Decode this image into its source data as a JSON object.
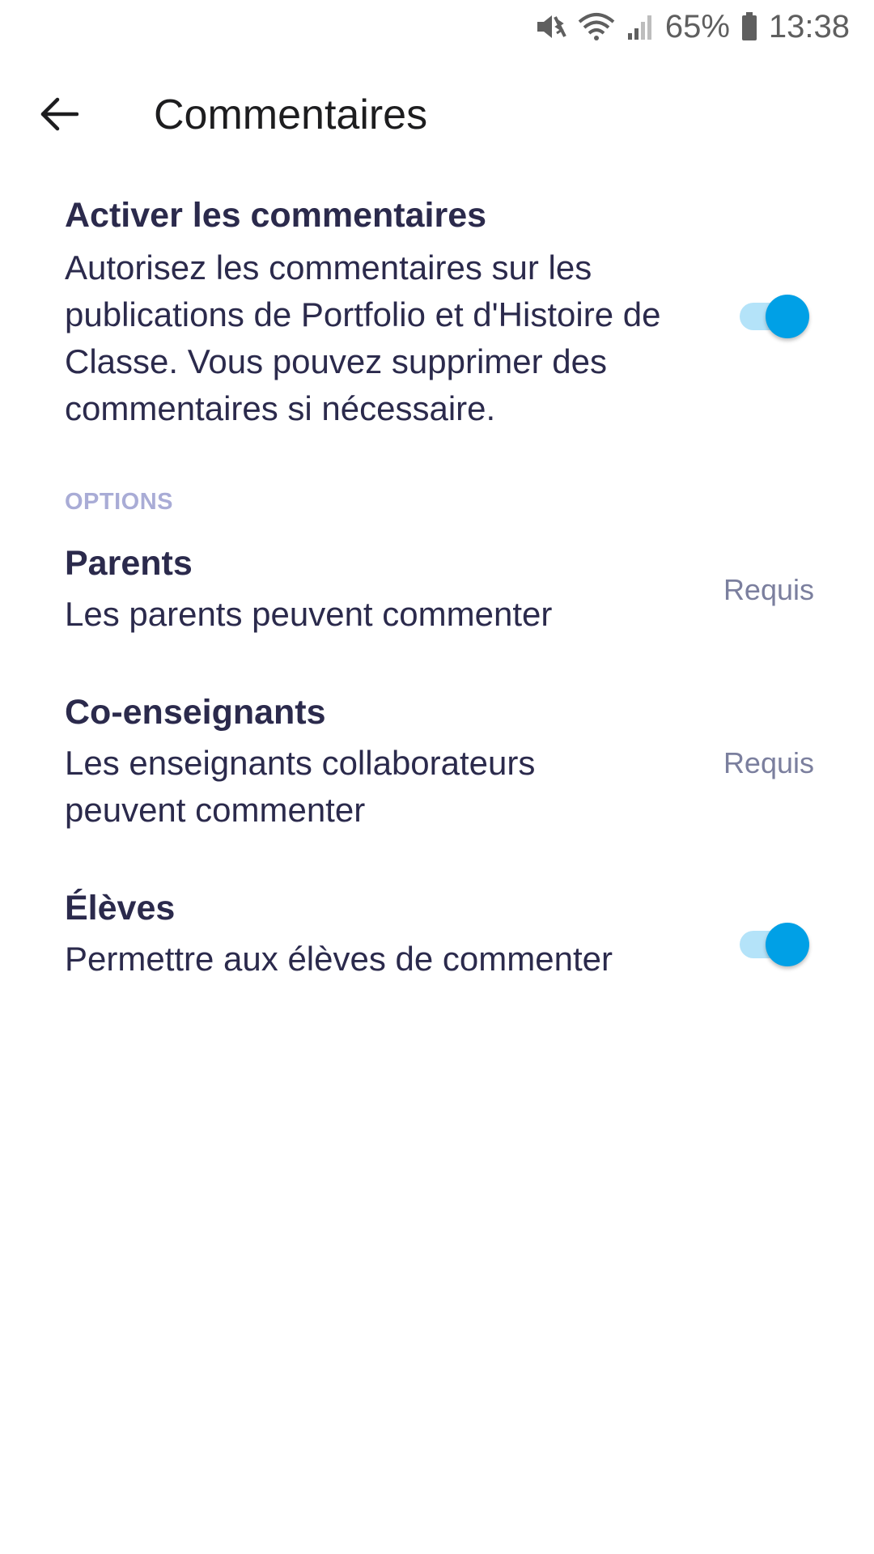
{
  "status_bar": {
    "battery": "65%",
    "time": "13:38"
  },
  "app_bar": {
    "title": "Commentaires"
  },
  "enable_comments": {
    "title": "Activer les commentaires",
    "description": "Autorisez les commentaires sur les publications de Portfolio et d'Histoire de Classe. Vous pouvez supprimer des commentaires si nécessaire.",
    "enabled": true
  },
  "options": {
    "label": "OPTIONS",
    "items": [
      {
        "title": "Parents",
        "description": "Les parents peuvent commenter",
        "status": "Requis"
      },
      {
        "title": "Co-enseignants",
        "description": "Les enseignants collaborateurs peuvent commenter",
        "status": "Requis"
      },
      {
        "title": "Élèves",
        "description": "Permettre aux élèves de commenter",
        "enabled": true
      }
    ]
  },
  "colors": {
    "accent": "#00a0e6",
    "text_primary": "#2b2a4c",
    "section_label": "#a9acd6"
  }
}
